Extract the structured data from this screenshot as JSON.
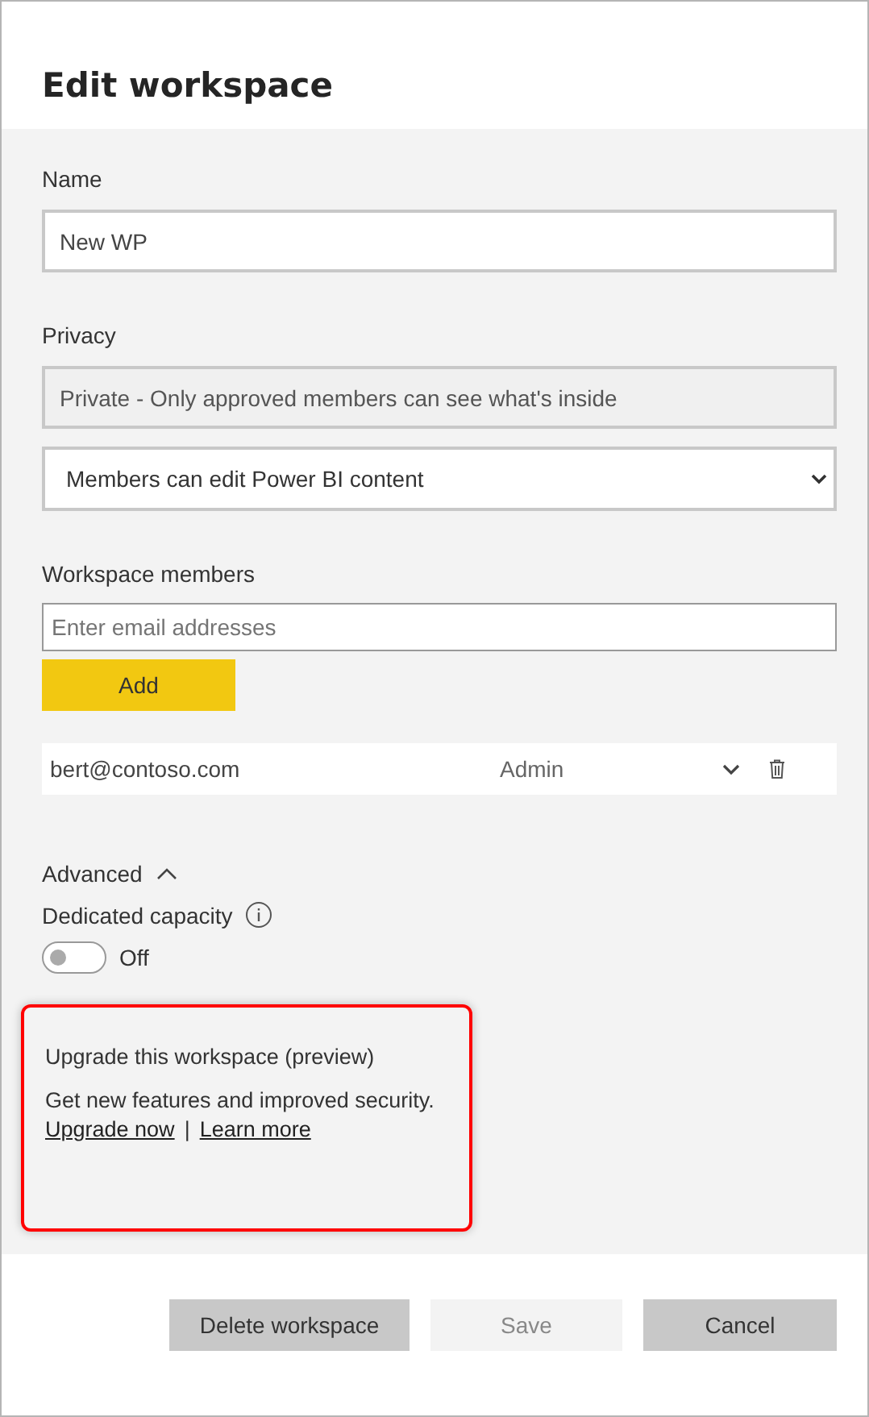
{
  "title": "Edit workspace",
  "name": {
    "label": "Name",
    "value": "New WP"
  },
  "privacy": {
    "label": "Privacy",
    "value": "Private - Only approved members can see what's inside",
    "disabled": true
  },
  "permission": {
    "value": "Members can edit Power BI content"
  },
  "members": {
    "label": "Workspace members",
    "placeholder": "Enter email addresses",
    "add_button": "Add",
    "rows": [
      {
        "email": "bert@contoso.com",
        "role": "Admin"
      }
    ]
  },
  "advanced": {
    "label": "Advanced",
    "expanded": true
  },
  "dedicated_capacity": {
    "label": "Dedicated capacity",
    "on": false,
    "state_text": "Off"
  },
  "upgrade": {
    "highlighted": true,
    "title": "Upgrade this workspace (preview)",
    "text": "Get new features and improved security.",
    "links": [
      "Upgrade now",
      "Learn more"
    ],
    "separator": "|"
  },
  "buttons": [
    {
      "label": "Delete workspace",
      "disabled": false
    },
    {
      "label": "Save",
      "disabled": true
    },
    {
      "label": "Cancel",
      "disabled": false
    }
  ]
}
